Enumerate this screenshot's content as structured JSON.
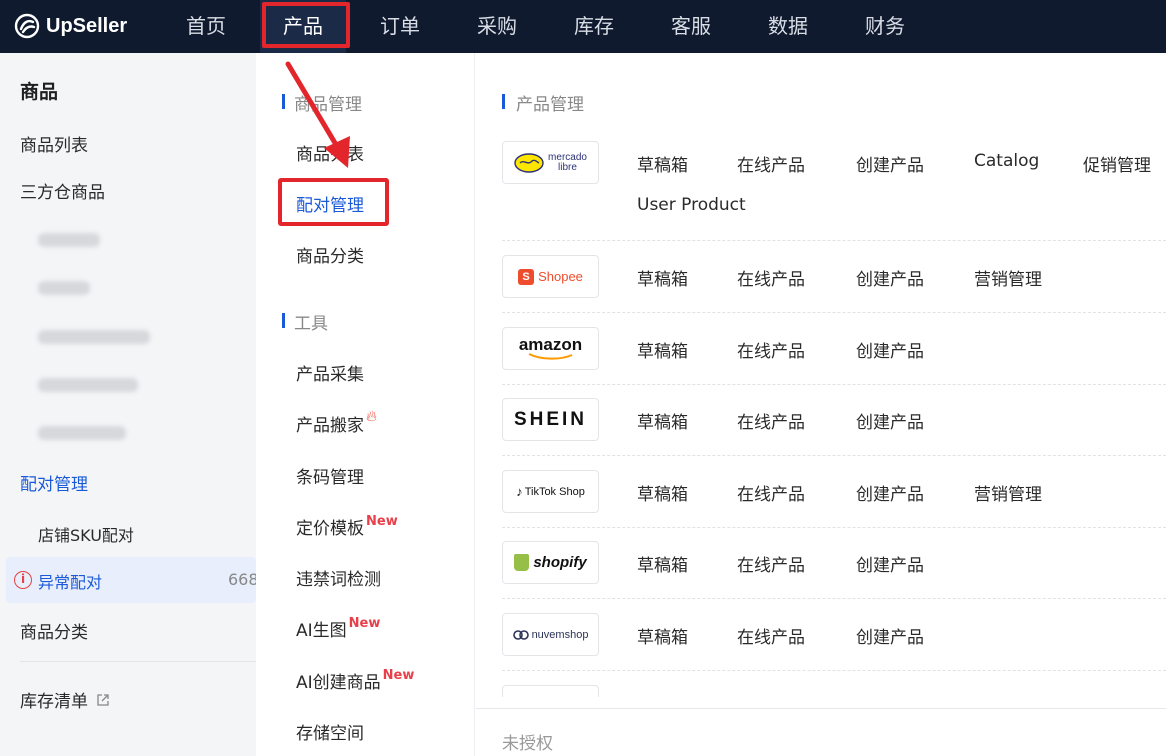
{
  "app": {
    "logo_text": "UpSeller"
  },
  "topnav": [
    "首页",
    "产品",
    "订单",
    "采购",
    "库存",
    "客服",
    "数据",
    "财务"
  ],
  "sidebar": {
    "title": "商品",
    "items": {
      "product_list": "商品列表",
      "third_party": "三方仓商品",
      "pairing": "配对管理",
      "store_sku": "店铺SKU配对",
      "abnormal": "异常配对",
      "abnormal_count": "668",
      "category": "商品分类",
      "inventory": "库存清单"
    }
  },
  "dropdown": {
    "section_product": "商品管理",
    "product_list": "商品列表",
    "pairing": "配对管理",
    "category": "商品分类",
    "section_tools": "工具",
    "collect": "产品采集",
    "move": "产品搬家",
    "barcode": "条码管理",
    "pricing": "定价模板",
    "banned": "违禁词检测",
    "ai_image": "AI生图",
    "ai_create": "AI创建商品",
    "storage": "存储空间",
    "new_tag": "New"
  },
  "right": {
    "title": "产品管理",
    "unauthorized": "未授权",
    "platforms": [
      {
        "name": "mercado libre",
        "links": [
          "草稿箱",
          "在线产品",
          "创建产品",
          "Catalog",
          "促销管理",
          "User Product"
        ]
      },
      {
        "name": "Shopee",
        "links": [
          "草稿箱",
          "在线产品",
          "创建产品",
          "营销管理"
        ]
      },
      {
        "name": "amazon",
        "links": [
          "草稿箱",
          "在线产品",
          "创建产品"
        ]
      },
      {
        "name": "SHEIN",
        "links": [
          "草稿箱",
          "在线产品",
          "创建产品"
        ]
      },
      {
        "name": "TikTok Shop",
        "links": [
          "草稿箱",
          "在线产品",
          "创建产品",
          "营销管理"
        ]
      },
      {
        "name": "shopify",
        "links": [
          "草稿箱",
          "在线产品",
          "创建产品"
        ]
      },
      {
        "name": "nuvemshop",
        "links": [
          "草稿箱",
          "在线产品",
          "创建产品"
        ]
      }
    ]
  },
  "colors": {
    "nav_bg": "#0f1a2e",
    "accent": "#1a5ad9",
    "highlight_red": "#e3262c",
    "new_red": "#e8404a"
  }
}
